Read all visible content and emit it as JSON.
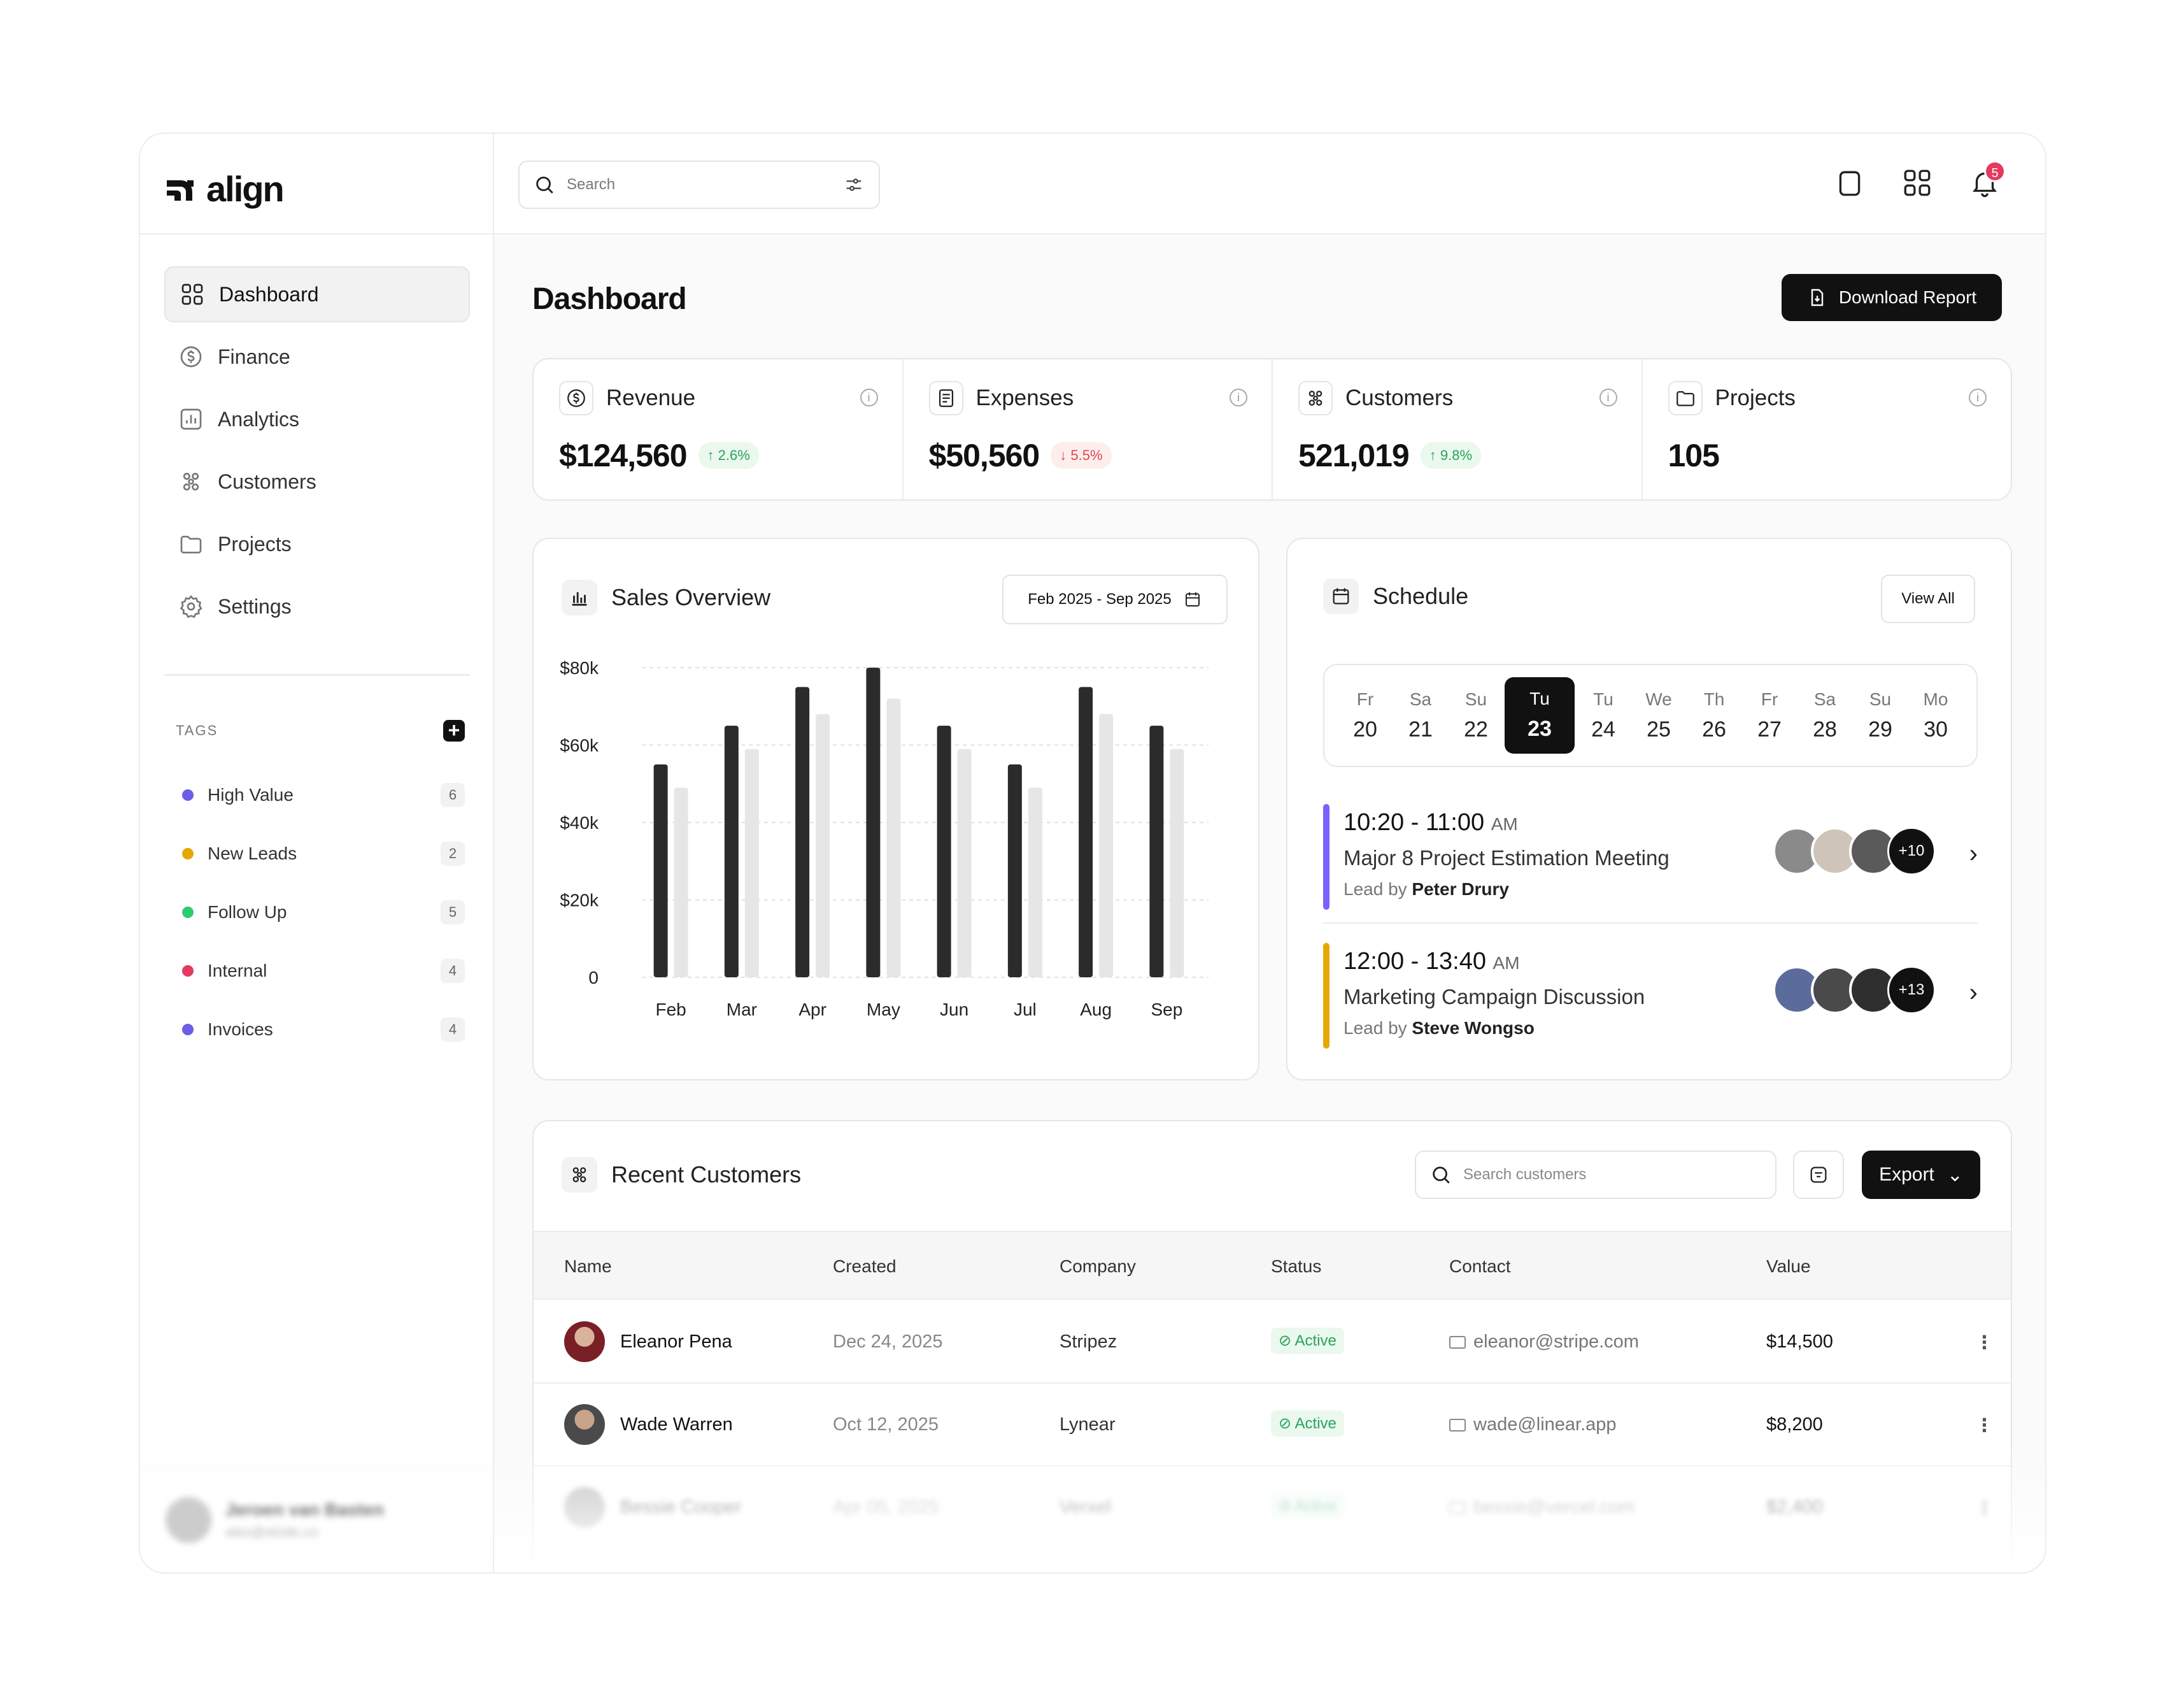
{
  "app": {
    "logo_text": "align"
  },
  "search": {
    "placeholder": "Search"
  },
  "topbar": {
    "notification_count": "5"
  },
  "sidebar": {
    "items": [
      {
        "label": "Dashboard",
        "icon": "grid-icon",
        "active": true
      },
      {
        "label": "Finance",
        "icon": "dollar-circle-icon"
      },
      {
        "label": "Analytics",
        "icon": "chart-icon"
      },
      {
        "label": "Customers",
        "icon": "users-icon"
      },
      {
        "label": "Projects",
        "icon": "folder-icon"
      },
      {
        "label": "Settings",
        "icon": "gear-icon"
      }
    ],
    "tags_title": "TAGS",
    "tags": [
      {
        "label": "High Value",
        "count": "6",
        "color": "#6c5ce7"
      },
      {
        "label": "New Leads",
        "count": "2",
        "color": "#e6a800"
      },
      {
        "label": "Follow Up",
        "count": "5",
        "color": "#2ecc71"
      },
      {
        "label": "Internal",
        "count": "4",
        "color": "#e5395f"
      },
      {
        "label": "Invoices",
        "count": "4",
        "color": "#6c5ce7"
      }
    ],
    "user": {
      "name": "Jeroen van Basten",
      "email": "alex@stride.co"
    }
  },
  "page": {
    "title": "Dashboard",
    "download_label": "Download Report"
  },
  "stats": [
    {
      "label": "Revenue",
      "value": "$124,560",
      "change": "2.6%",
      "dir": "up"
    },
    {
      "label": "Expenses",
      "value": "$50,560",
      "change": "5.5%",
      "dir": "down"
    },
    {
      "label": "Customers",
      "value": "521,019",
      "change": "9.8%",
      "dir": "up"
    },
    {
      "label": "Projects",
      "value": "105",
      "change": "",
      "dir": ""
    }
  ],
  "sales": {
    "title": "Sales Overview",
    "range": "Feb 2025 - Sep 2025"
  },
  "chart_data": {
    "type": "bar",
    "categories": [
      "Feb",
      "Mar",
      "Apr",
      "May",
      "Jun",
      "Jul",
      "Aug",
      "Sep"
    ],
    "series": [
      {
        "values": [
          55000,
          65000,
          75000,
          80000,
          65000,
          55000,
          75000,
          65000
        ],
        "color": "#2b2b2b"
      },
      {
        "values": [
          49000,
          59000,
          68000,
          72000,
          59000,
          49000,
          68000,
          59000
        ],
        "color": "#e6e6e6"
      }
    ],
    "yticks": [
      "$80k",
      "$60k",
      "$40k",
      "$20k",
      "0"
    ],
    "ylim": [
      0,
      80000
    ],
    "grid": true
  },
  "schedule": {
    "title": "Schedule",
    "view_all": "View All",
    "days": [
      {
        "name": "Fr",
        "date": "20"
      },
      {
        "name": "Sa",
        "date": "21"
      },
      {
        "name": "Su",
        "date": "22"
      },
      {
        "name": "Tu",
        "date": "23",
        "selected": true
      },
      {
        "name": "Tu",
        "date": "24"
      },
      {
        "name": "We",
        "date": "25"
      },
      {
        "name": "Th",
        "date": "26"
      },
      {
        "name": "Fr",
        "date": "27"
      },
      {
        "name": "Sa",
        "date": "28"
      },
      {
        "name": "Su",
        "date": "29"
      },
      {
        "name": "Mo",
        "date": "30"
      }
    ],
    "events": [
      {
        "time": "10:20 - 11:00",
        "ampm": "AM",
        "title": "Major 8 Project Estimation Meeting",
        "lead_prefix": "Lead by",
        "lead": "Peter Drury",
        "more": "+10",
        "color": "#7b61ff"
      },
      {
        "time": "12:00 - 13:40",
        "ampm": "AM",
        "title": "Marketing Campaign Discussion",
        "lead_prefix": "Lead by",
        "lead": "Steve Wongso",
        "more": "+13",
        "color": "#e6a800"
      }
    ]
  },
  "customers": {
    "title": "Recent Customers",
    "search_placeholder": "Search customers",
    "export_label": "Export",
    "columns": [
      "Name",
      "Created",
      "Company",
      "Status",
      "Contact",
      "Value"
    ],
    "rows": [
      {
        "name": "Eleanor Pena",
        "created": "Dec 24, 2025",
        "company": "Stripez",
        "status": "Active",
        "contact": "eleanor@stripe.com",
        "value": "$14,500"
      },
      {
        "name": "Wade Warren",
        "created": "Oct 12, 2025",
        "company": "Lynear",
        "status": "Active",
        "contact": "wade@linear.app",
        "value": "$8,200"
      },
      {
        "name": "Bessie Cooper",
        "created": "Apr 05, 2025",
        "company": "Verxel",
        "status": "Active",
        "contact": "bessie@vercel.com",
        "value": "$2,400"
      }
    ]
  }
}
